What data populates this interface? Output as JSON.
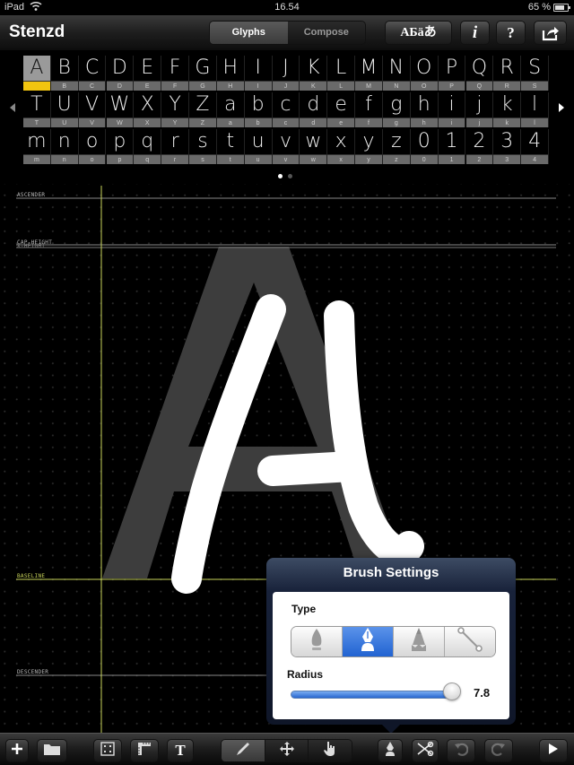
{
  "status_bar": {
    "device": "iPad",
    "time": "16.54",
    "battery": "65 %",
    "battery_level": 0.65
  },
  "nav": {
    "title": "Stenzd",
    "tabs": [
      {
        "label": "Glyphs",
        "selected": true
      },
      {
        "label": "Compose",
        "selected": false
      }
    ],
    "buttons": {
      "language": "АБäあ",
      "info": "i",
      "help": "?",
      "share": "share-icon"
    }
  },
  "glyph_grid": {
    "selected": "A",
    "rows": [
      [
        "A",
        "B",
        "C",
        "D",
        "E",
        "F",
        "G",
        "H",
        "I",
        "J",
        "K",
        "L",
        "M",
        "N",
        "O",
        "P",
        "Q",
        "R",
        "S"
      ],
      [
        "T",
        "U",
        "V",
        "W",
        "X",
        "Y",
        "Z",
        "a",
        "b",
        "c",
        "d",
        "e",
        "f",
        "g",
        "h",
        "i",
        "j",
        "k",
        "l"
      ],
      [
        "m",
        "n",
        "o",
        "p",
        "q",
        "r",
        "s",
        "t",
        "u",
        "v",
        "w",
        "x",
        "y",
        "z",
        "0",
        "1",
        "2",
        "3",
        "4"
      ]
    ],
    "pages": 2,
    "current_page": 1
  },
  "canvas": {
    "metrics": {
      "ascender": "ASCENDER",
      "cap_height": "CAP-HEIGHT",
      "x_height": "X-HEIGHT",
      "baseline": "BASELINE",
      "descender": "DESCENDER"
    },
    "reference_glyph": "A",
    "guide_color": "#c8d45a"
  },
  "brush_settings": {
    "title": "Brush Settings",
    "type_label": "Type",
    "types": [
      {
        "name": "flame-brush",
        "selected": false
      },
      {
        "name": "pen-nib",
        "selected": true
      },
      {
        "name": "pencil",
        "selected": false
      },
      {
        "name": "line",
        "selected": false
      }
    ],
    "radius_label": "Radius",
    "radius_value": "7.8",
    "radius_fraction": 0.96
  },
  "toolbar": {
    "items": [
      "add",
      "open-folder",
      "frame",
      "ruler",
      "text",
      "brush",
      "move",
      "hand",
      "pen-tool",
      "cut",
      "undo",
      "redo",
      "play"
    ],
    "active_tool": "brush",
    "undo_enabled": false,
    "redo_enabled": false
  },
  "colors": {
    "accent_blue": "#2163d1",
    "selection_yellow": "#f1c40f"
  }
}
